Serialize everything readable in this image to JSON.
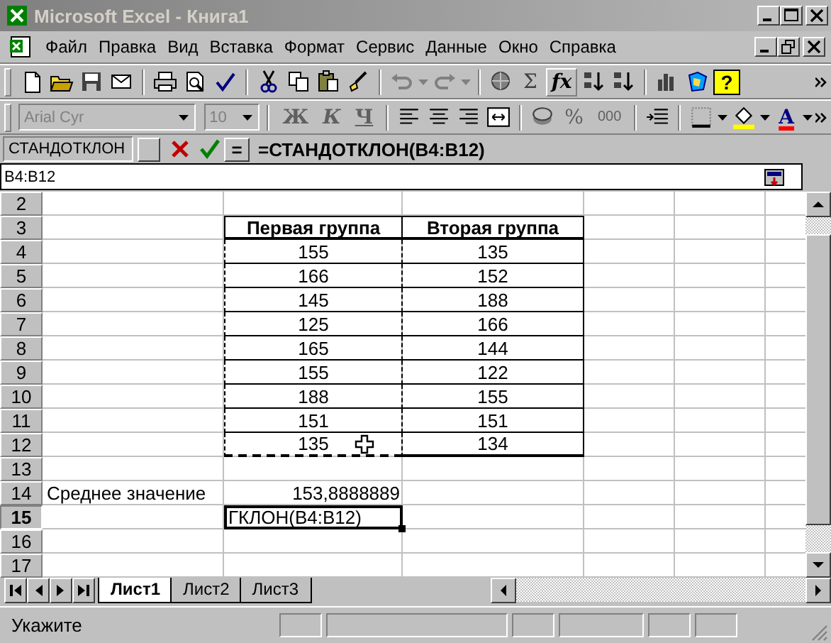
{
  "window": {
    "title": "Microsoft Excel - Книга1",
    "active": false
  },
  "menu": [
    "Файл",
    "Правка",
    "Вид",
    "Вставка",
    "Формат",
    "Сервис",
    "Данные",
    "Окно",
    "Справка"
  ],
  "standard_toolbar": {
    "sum": "Σ",
    "function": "fx",
    "help": "?"
  },
  "formatting_toolbar": {
    "font": "Arial Cyr",
    "size": "10",
    "bold": "Ж",
    "italic": "К",
    "underline": "Ч",
    "percent": "%",
    "thousands": "000",
    "font_color": "A",
    "disabled": true
  },
  "formula_bar": {
    "name_box": "СТАНДОТКЛОН",
    "equals": "=",
    "formula": "=СТАНДОТКЛОН(B4:B12)"
  },
  "range_field": {
    "value": "B4:B12"
  },
  "sheet": {
    "rows": [
      {
        "number": "2",
        "selected": false,
        "kind": "plain"
      },
      {
        "number": "3",
        "selected": false,
        "kind": "header",
        "column_2": "Первая группа",
        "column_3": "Вторая группа"
      },
      {
        "number": "4",
        "selected": false,
        "kind": "data",
        "column_2": "155",
        "column_3": "135"
      },
      {
        "number": "5",
        "selected": false,
        "kind": "data",
        "column_2": "166",
        "column_3": "152"
      },
      {
        "number": "6",
        "selected": false,
        "kind": "data",
        "column_2": "145",
        "column_3": "188"
      },
      {
        "number": "7",
        "selected": false,
        "kind": "data",
        "column_2": "125",
        "column_3": "166"
      },
      {
        "number": "8",
        "selected": false,
        "kind": "data",
        "column_2": "165",
        "column_3": "144"
      },
      {
        "number": "9",
        "selected": false,
        "kind": "data",
        "column_2": "155",
        "column_3": "122"
      },
      {
        "number": "10",
        "selected": false,
        "kind": "data",
        "column_2": "188",
        "column_3": "155"
      },
      {
        "number": "11",
        "selected": false,
        "kind": "data",
        "column_2": "151",
        "column_3": "151"
      },
      {
        "number": "12",
        "selected": false,
        "kind": "data",
        "column_2": "135",
        "column_3": "134"
      },
      {
        "number": "13",
        "selected": false,
        "kind": "plain"
      },
      {
        "number": "14",
        "selected": false,
        "kind": "plain",
        "column_1": "Среднее значение",
        "column_2": "153,8888889"
      },
      {
        "number": "15",
        "selected": true,
        "kind": "edit",
        "column_2": "ГКЛОН(B4:B12)"
      },
      {
        "number": "16",
        "selected": false,
        "kind": "plain"
      },
      {
        "number": "17",
        "selected": false,
        "kind": "plain"
      }
    ]
  },
  "sheet_tabs": [
    {
      "label": "Лист1",
      "selected": true
    },
    {
      "label": "Лист2",
      "selected": false
    },
    {
      "label": "Лист3",
      "selected": false
    }
  ],
  "status_bar": {
    "mode": "Укажите"
  }
}
